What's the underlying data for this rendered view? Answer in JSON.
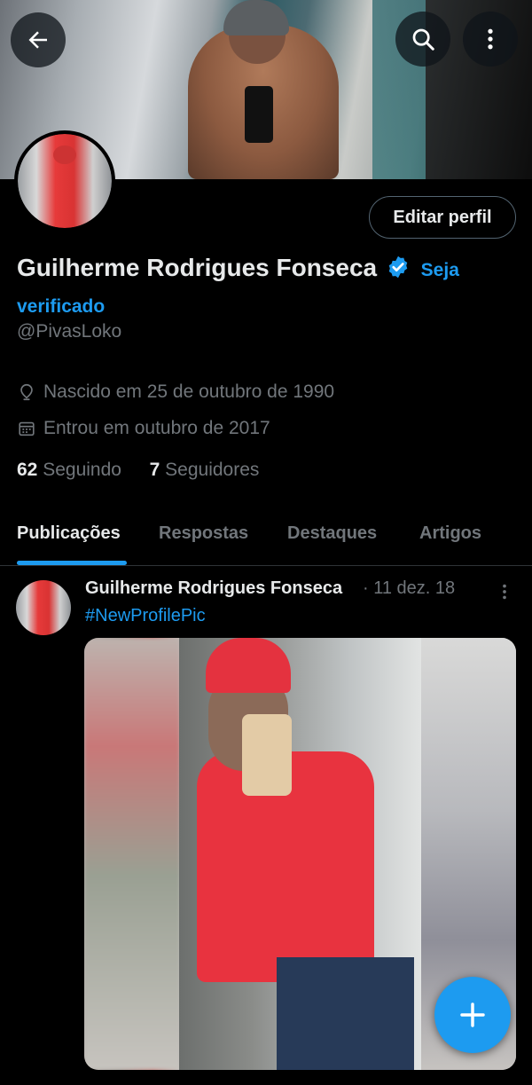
{
  "header": {
    "back_icon": "arrow-left-icon",
    "search_icon": "search-icon",
    "more_icon": "more-vertical-icon"
  },
  "profile": {
    "name": "Guilherme Rodrigues Fonseca",
    "verify_link": "Seja verificado",
    "handle": "@PivasLoko",
    "edit_button": "Editar perfil",
    "born": "Nascido em 25 de outubro de 1990",
    "joined": "Entrou em outubro de 2017",
    "following_count": "62",
    "following_label": "Seguindo",
    "followers_count": "7",
    "followers_label": "Seguidores"
  },
  "tabs": [
    {
      "label": "Publicações",
      "active": true
    },
    {
      "label": "Respostas",
      "active": false
    },
    {
      "label": "Destaques",
      "active": false
    },
    {
      "label": "Artigos",
      "active": false
    }
  ],
  "post": {
    "author": "Guilherme Rodrigues Fonseca",
    "date": "· 11 dez. 18",
    "text": "#NewProfilePic"
  },
  "colors": {
    "accent": "#1d9bf0",
    "background": "#000000",
    "secondary_text": "#71767b",
    "primary_text": "#e7e9ea"
  }
}
